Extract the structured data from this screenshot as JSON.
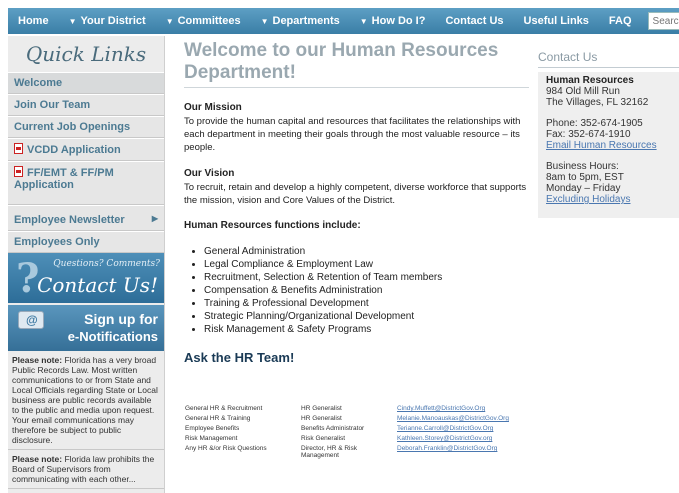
{
  "nav": {
    "items": [
      "Home",
      "Your District",
      "Committees",
      "Departments",
      "How Do I?",
      "Contact Us",
      "Useful Links",
      "FAQ"
    ],
    "search_placeholder": "Search"
  },
  "sidebar": {
    "title": "Quick Links",
    "items": [
      "Welcome",
      "Join Our Team",
      "Current Job Openings",
      "VCDD Application",
      "FF/EMT & FF/PM Application",
      "Employee Newsletter",
      "Employees Only"
    ],
    "contact_banner": {
      "small": "Questions? Comments?",
      "big": "Contact Us!"
    },
    "signup_banner": {
      "line1": "Sign up for",
      "line2": "e-Notifications"
    },
    "note1": {
      "bold": "Please note:",
      "text": " Florida has a very broad Public Records Law. Most written communications to or from State and Local Officials regarding State or Local business are public records available to the public and media upon request. Your email communications may therefore be subject to public disclosure."
    },
    "note2": {
      "bold": "Please note:",
      "text": " Florida law prohibits the Board of Supervisors from communicating with each other..."
    }
  },
  "main": {
    "title": "Welcome to our Human Resources Department!",
    "mission_head": "Our Mission",
    "mission_text": "To provide the human capital and resources that facilitates the relationships with each department in meeting their goals through the most valuable resource – its people.",
    "vision_head": "Our Vision",
    "vision_text": "To recruit, retain and develop a highly competent, diverse workforce that supports the mission, vision and Core Values of the District.",
    "functions_head": "Human Resources functions include:",
    "functions": [
      "General Administration",
      "Legal Compliance & Employment Law",
      "Recruitment, Selection & Retention of Team members",
      "Compensation & Benefits Administration",
      "Training & Professional Development",
      "Strategic Planning/Organizational Development",
      "Risk Management & Safety Programs"
    ],
    "ask_head": "Ask the HR Team!",
    "team": [
      {
        "area": "General HR & Recruitment",
        "role": "HR Generalist",
        "email": "Cindy.Muffett@DistrictGov.Org"
      },
      {
        "area": "General HR & Training",
        "role": "HR Generalist",
        "email": "Melanie.Manoauskas@DistrictGov.Org"
      },
      {
        "area": "Employee Benefits",
        "role": "Benefits Administrator",
        "email": "Terianne.Carroll@DistrictGov.Org"
      },
      {
        "area": "Risk Management",
        "role": "Risk Generalist",
        "email": "Kathleen.Storey@DistrictGov.org"
      },
      {
        "area": "Any HR &/or Risk Questions",
        "role": "Director, HR & Risk Management",
        "email": "Deborah.Franklin@DistrictGov.Org"
      }
    ]
  },
  "contact": {
    "title": "Contact Us",
    "dept": "Human Resources",
    "address1": "984 Old Mill Run",
    "address2": "The Villages, FL 32162",
    "phone": "Phone: 352-674-1905",
    "fax": "Fax: 352-674-1910",
    "email_link": "Email Human Resources",
    "hours_label": "Business Hours:",
    "hours": "8am to 5pm, EST",
    "days": "Monday – Friday",
    "holidays_link": "Excluding Holidays"
  }
}
